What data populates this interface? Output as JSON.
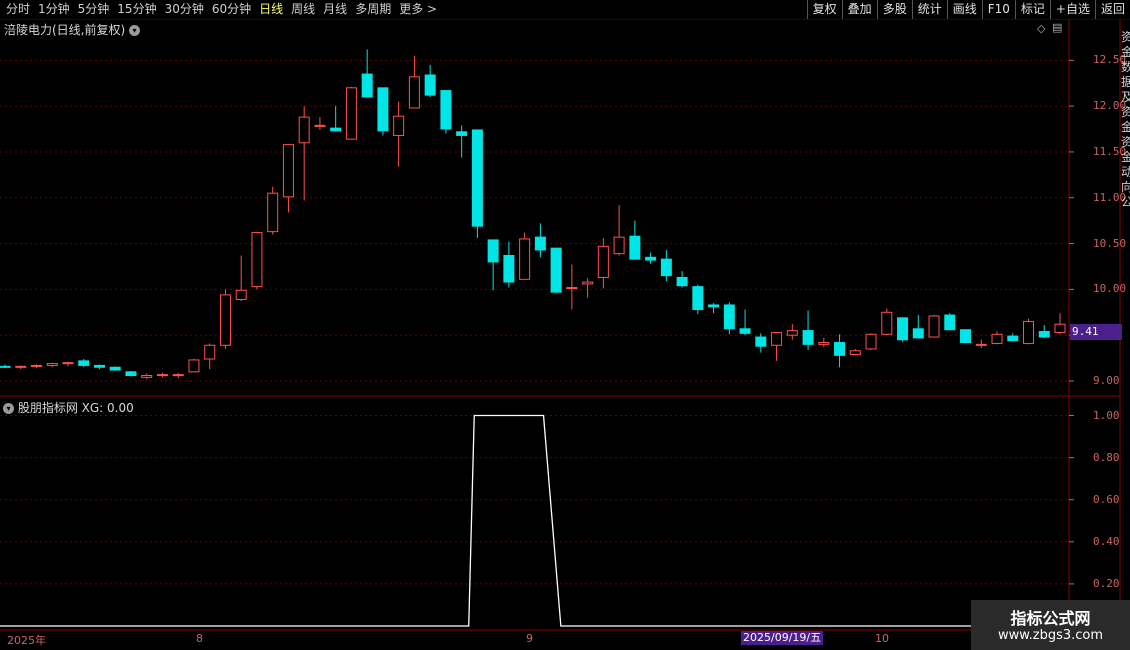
{
  "toolbar": {
    "periods": [
      "分时",
      "1分钟",
      "5分钟",
      "15分钟",
      "30分钟",
      "60分钟",
      "日线",
      "周线",
      "月线",
      "多周期",
      "更多 >"
    ],
    "active_period": "日线",
    "actions": [
      "复权",
      "叠加",
      "多股",
      "统计",
      "画线",
      "F10",
      "标记",
      "+自选",
      "返回"
    ]
  },
  "main_panel": {
    "title": "涪陵电力(日线,前复权)",
    "current_price": "9.41",
    "diamond": "◇",
    "menu_icon": "▤"
  },
  "indicator_panel": {
    "title": "股朋指标网 XG: 0.00"
  },
  "right_strip_text": "资金数据及资金资金动向公",
  "x_axis": {
    "labels": [
      "2025年",
      "8",
      "9",
      "10"
    ],
    "cursor_date": "2025/09/19/五"
  },
  "watermark": {
    "line1": "指标公式网",
    "line2": "www.zbgs3.com"
  },
  "colors": {
    "up": "#ff5050",
    "down": "#00e5e5",
    "grid": "#6b0000",
    "axis": "#c86464",
    "indicator": "#ffffff"
  },
  "chart_data": [
    {
      "type": "candlestick",
      "title": "涪陵电力(日线,前复权)",
      "ylim": [
        8.88,
        12.82
      ],
      "yticks": [
        "12.50",
        "12.00",
        "11.50",
        "11.00",
        "10.50",
        "10.00",
        "9.50",
        "9.00"
      ],
      "ytick_values": [
        12.5,
        12.0,
        11.5,
        11.0,
        10.5,
        10.0,
        9.5,
        9.0
      ],
      "ohlc": [
        [
          9.16,
          9.18,
          9.14,
          9.15
        ],
        [
          9.15,
          9.17,
          9.13,
          9.16
        ],
        [
          9.16,
          9.18,
          9.14,
          9.17
        ],
        [
          9.17,
          9.2,
          9.15,
          9.19
        ],
        [
          9.19,
          9.21,
          9.16,
          9.2
        ],
        [
          9.22,
          9.24,
          9.15,
          9.17
        ],
        [
          9.17,
          9.18,
          9.13,
          9.15
        ],
        [
          9.15,
          9.16,
          9.11,
          9.12
        ],
        [
          9.1,
          9.11,
          9.05,
          9.06
        ],
        [
          9.04,
          9.08,
          9.02,
          9.06
        ],
        [
          9.06,
          9.09,
          9.04,
          9.07
        ],
        [
          9.07,
          9.09,
          9.03,
          9.07
        ],
        [
          9.1,
          9.24,
          9.1,
          9.23
        ],
        [
          9.24,
          9.41,
          9.13,
          9.39
        ],
        [
          9.39,
          10.0,
          9.35,
          9.94
        ],
        [
          9.89,
          10.37,
          9.87,
          9.99
        ],
        [
          10.03,
          10.63,
          10.0,
          10.62
        ],
        [
          10.63,
          11.12,
          10.6,
          11.05
        ],
        [
          11.01,
          11.58,
          10.84,
          11.58
        ],
        [
          11.6,
          12.0,
          10.97,
          11.88
        ],
        [
          11.79,
          11.88,
          11.74,
          11.79
        ],
        [
          11.76,
          12.0,
          11.72,
          11.73
        ],
        [
          11.64,
          12.21,
          11.64,
          12.2
        ],
        [
          12.35,
          12.62,
          12.11,
          12.1
        ],
        [
          12.2,
          12.2,
          11.68,
          11.73
        ],
        [
          11.68,
          12.05,
          11.34,
          11.89
        ],
        [
          11.98,
          12.55,
          11.98,
          12.32
        ],
        [
          12.34,
          12.45,
          12.1,
          12.12
        ],
        [
          12.17,
          12.17,
          11.7,
          11.75
        ],
        [
          11.72,
          11.79,
          11.44,
          11.68
        ],
        [
          11.74,
          11.74,
          10.56,
          10.69
        ],
        [
          10.54,
          10.54,
          9.99,
          10.3
        ],
        [
          10.37,
          10.52,
          10.02,
          10.08
        ],
        [
          10.11,
          10.62,
          10.11,
          10.55
        ],
        [
          10.57,
          10.72,
          10.35,
          10.43
        ],
        [
          10.45,
          10.45,
          9.96,
          9.97
        ],
        [
          10.01,
          10.27,
          9.78,
          10.02
        ],
        [
          10.06,
          10.12,
          9.91,
          10.08
        ],
        [
          10.13,
          10.56,
          10.01,
          10.47
        ],
        [
          10.39,
          10.92,
          10.37,
          10.57
        ],
        [
          10.58,
          10.75,
          10.33,
          10.33
        ],
        [
          10.35,
          10.4,
          10.28,
          10.32
        ],
        [
          10.33,
          10.43,
          10.09,
          10.15
        ],
        [
          10.13,
          10.2,
          10.02,
          10.04
        ],
        [
          10.03,
          10.05,
          9.73,
          9.78
        ],
        [
          9.83,
          9.85,
          9.74,
          9.81
        ],
        [
          9.83,
          9.86,
          9.51,
          9.57
        ],
        [
          9.57,
          9.78,
          9.5,
          9.52
        ],
        [
          9.48,
          9.52,
          9.31,
          9.38
        ],
        [
          9.39,
          9.53,
          9.22,
          9.53
        ],
        [
          9.5,
          9.62,
          9.45,
          9.55
        ],
        [
          9.55,
          9.77,
          9.34,
          9.4
        ],
        [
          9.4,
          9.47,
          9.37,
          9.42
        ],
        [
          9.42,
          9.51,
          9.15,
          9.28
        ],
        [
          9.29,
          9.35,
          9.28,
          9.33
        ],
        [
          9.35,
          9.52,
          9.34,
          9.51
        ],
        [
          9.51,
          9.79,
          9.5,
          9.75
        ],
        [
          9.69,
          9.69,
          9.43,
          9.45
        ],
        [
          9.57,
          9.72,
          9.47,
          9.47
        ],
        [
          9.48,
          9.72,
          9.48,
          9.71
        ],
        [
          9.72,
          9.74,
          9.56,
          9.56
        ],
        [
          9.56,
          9.56,
          9.42,
          9.42
        ],
        [
          9.4,
          9.45,
          9.36,
          9.4
        ],
        [
          9.41,
          9.54,
          9.4,
          9.51
        ],
        [
          9.49,
          9.52,
          9.44,
          9.44
        ],
        [
          9.41,
          9.68,
          9.4,
          9.65
        ],
        [
          9.54,
          9.61,
          9.47,
          9.48
        ],
        [
          9.53,
          9.74,
          9.51,
          9.62
        ]
      ]
    },
    {
      "type": "line",
      "series": [
        {
          "name": "XG"
        }
      ],
      "ylim": [
        0,
        1.05
      ],
      "yticks": [
        "1.00",
        "0.80",
        "0.60",
        "0.40",
        "0.20"
      ],
      "ytick_values": [
        1.0,
        0.8,
        0.6,
        0.4,
        0.2
      ],
      "points": [
        [
          0,
          0
        ],
        [
          29,
          0
        ],
        [
          30,
          1
        ],
        [
          34,
          1
        ],
        [
          35,
          0
        ],
        [
          67,
          0
        ]
      ]
    }
  ]
}
